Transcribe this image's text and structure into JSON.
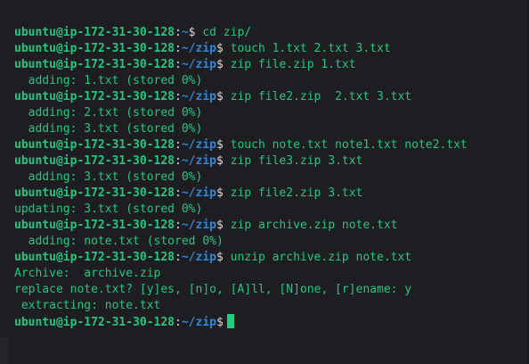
{
  "terminal": {
    "colors": {
      "background": "#1d1d22",
      "user_host": "#24c77e",
      "path": "#2f88dc",
      "text": "#24c77e",
      "cursor": "#1fd17c"
    },
    "lines": [
      {
        "type": "prompt",
        "user": "ubuntu@ip-172-31-30-128",
        "sep": ":",
        "path": "~",
        "symbol": "$",
        "command": " cd zip/"
      },
      {
        "type": "prompt",
        "user": "ubuntu@ip-172-31-30-128",
        "sep": ":",
        "path": "~/zip",
        "symbol": "$",
        "command": " touch 1.txt 2.txt 3.txt"
      },
      {
        "type": "prompt",
        "user": "ubuntu@ip-172-31-30-128",
        "sep": ":",
        "path": "~/zip",
        "symbol": "$",
        "command": " zip file.zip 1.txt"
      },
      {
        "type": "output",
        "text": "  adding: 1.txt (stored 0%)"
      },
      {
        "type": "prompt",
        "user": "ubuntu@ip-172-31-30-128",
        "sep": ":",
        "path": "~/zip",
        "symbol": "$",
        "command": " zip file2.zip  2.txt 3.txt"
      },
      {
        "type": "output",
        "text": "  adding: 2.txt (stored 0%)"
      },
      {
        "type": "output",
        "text": "  adding: 3.txt (stored 0%)"
      },
      {
        "type": "prompt",
        "user": "ubuntu@ip-172-31-30-128",
        "sep": ":",
        "path": "~/zip",
        "symbol": "$",
        "command": " touch note.txt note1.txt note2.txt"
      },
      {
        "type": "prompt",
        "user": "ubuntu@ip-172-31-30-128",
        "sep": ":",
        "path": "~/zip",
        "symbol": "$",
        "command": " zip file3.zip 3.txt"
      },
      {
        "type": "output",
        "text": "  adding: 3.txt (stored 0%)"
      },
      {
        "type": "prompt",
        "user": "ubuntu@ip-172-31-30-128",
        "sep": ":",
        "path": "~/zip",
        "symbol": "$",
        "command": " zip file2.zip 3.txt"
      },
      {
        "type": "output",
        "text": "updating: 3.txt (stored 0%)"
      },
      {
        "type": "prompt",
        "user": "ubuntu@ip-172-31-30-128",
        "sep": ":",
        "path": "~/zip",
        "symbol": "$",
        "command": " zip archive.zip note.txt"
      },
      {
        "type": "output",
        "text": "  adding: note.txt (stored 0%)"
      },
      {
        "type": "prompt",
        "user": "ubuntu@ip-172-31-30-128",
        "sep": ":",
        "path": "~/zip",
        "symbol": "$",
        "command": " unzip archive.zip note.txt"
      },
      {
        "type": "output",
        "text": "Archive:  archive.zip"
      },
      {
        "type": "output",
        "text": "replace note.txt? [y]es, [n]o, [A]ll, [N]one, [r]ename: y"
      },
      {
        "type": "output",
        "text": " extracting: note.txt"
      },
      {
        "type": "prompt",
        "user": "ubuntu@ip-172-31-30-128",
        "sep": ":",
        "path": "~/zip",
        "symbol": "$",
        "command": "",
        "cursor": true
      }
    ]
  }
}
